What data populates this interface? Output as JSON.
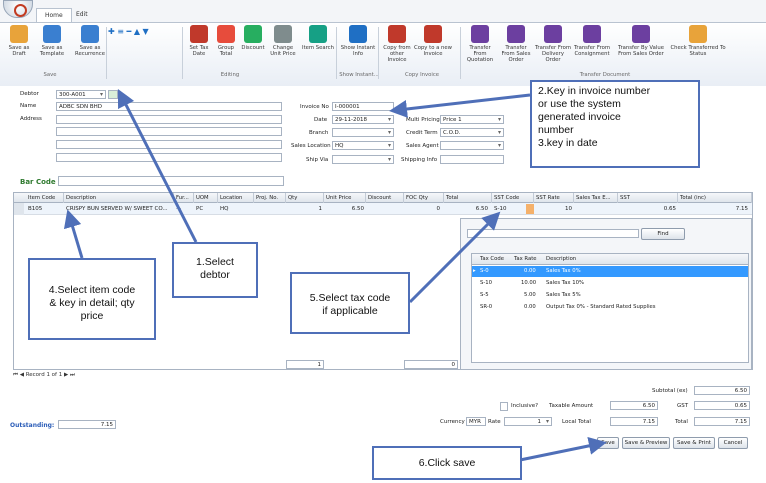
{
  "ribbon": {
    "tabs": [
      "Home",
      "Edit"
    ],
    "buttons": [
      {
        "label": "Save as Draft",
        "icon": "save-draft-icon",
        "color": "#e8a33a"
      },
      {
        "label": "Save as Template",
        "icon": "save-template-icon",
        "color": "#3a7fd0"
      },
      {
        "label": "Save as Recurrence",
        "icon": "save-recurrence-icon",
        "color": "#3a7fd0"
      },
      {
        "label": "Set Tax Date",
        "icon": "gst-icon",
        "color": "#c0392b"
      },
      {
        "label": "Group Total",
        "icon": "group-total-icon",
        "color": "#e74c3c"
      },
      {
        "label": "Discount",
        "icon": "discount-icon",
        "color": "#27ae60"
      },
      {
        "label": "Change Unit Price",
        "icon": "change-price-icon",
        "color": "#7f8c8d"
      },
      {
        "label": "Item Search",
        "icon": "item-search-icon",
        "color": "#16a085"
      },
      {
        "label": "Show Instant Info",
        "icon": "info-icon",
        "color": "#1f6fc4"
      },
      {
        "label": "Copy from other Invoice",
        "icon": "copy-invoice-icon",
        "color": "#c0392b"
      },
      {
        "label": "Copy to a new Invoice",
        "icon": "copy-new-invoice-icon",
        "color": "#c0392b"
      },
      {
        "label": "Transfer From Quotation",
        "icon": "transfer-quotation-icon",
        "color": "#6c3fa0"
      },
      {
        "label": "Transfer From Sales Order",
        "icon": "transfer-sales-order-icon",
        "color": "#6c3fa0"
      },
      {
        "label": "Transfer From Delivery Order",
        "icon": "transfer-delivery-icon",
        "color": "#6c3fa0"
      },
      {
        "label": "Transfer From Consignment",
        "icon": "transfer-consignment-icon",
        "color": "#6c3fa0"
      },
      {
        "label": "Transfer By Value From Sales Order",
        "icon": "transfer-by-value-icon",
        "color": "#6c3fa0"
      },
      {
        "label": "Check Transferred To Status",
        "icon": "check-status-icon",
        "color": "#e8a33a"
      }
    ],
    "groups": [
      "Save",
      "Editing",
      "Show Instant...",
      "Copy Invoice",
      "Transfer Document"
    ]
  },
  "header": {
    "debtor_label": "Debtor",
    "debtor_value": "300-A001",
    "name_label": "Name",
    "name_value": "ADBC SDN BHD",
    "address_label": "Address",
    "invoice_no_label": "Invoice No",
    "invoice_no_value": "I-000001",
    "date_label": "Date",
    "date_value": "29-11-2018",
    "branch_label": "Branch",
    "sales_location_label": "Sales Location",
    "sales_location_value": "HQ",
    "ship_via_label": "Ship Via",
    "multi_pricing_label": "Multi Pricing",
    "multi_pricing_value": "Price 1",
    "credit_term_label": "Credit Term",
    "credit_term_value": "C.O.D.",
    "sales_agent_label": "Sales Agent",
    "shipping_info_label": "Shipping Info",
    "barcode_label": "Bar Code"
  },
  "grid": {
    "columns": [
      "Item Code",
      "Description",
      "Fur...",
      "UOM",
      "Location",
      "Proj. No.",
      "Qty",
      "Unit Price",
      "Discount",
      "FOC Qty",
      "Total",
      "SST Code",
      "SST Rate",
      "Sales Tax E...",
      "SST",
      "Total (inc)"
    ],
    "row": {
      "item_code": "B105",
      "description": "CRISPY BUN SERVED W/ SWEET CO...",
      "furthers": "···",
      "uom": "PC",
      "location": "HQ",
      "qty": "1",
      "unit_price": "6.50",
      "foc_qty": "0",
      "total": "6.50",
      "sst_code": "S-10",
      "sst_rate": "10",
      "sst": "0.65",
      "total_inc": "7.15"
    },
    "footer_qty": "1",
    "footer_foc": "0"
  },
  "tax_popup": {
    "find_label": "Find",
    "columns": [
      "Tax Code",
      "Tax Rate",
      "Description"
    ],
    "rows": [
      {
        "code": "S-0",
        "rate": "0.00",
        "desc": "Sales Tax 0%"
      },
      {
        "code": "S-10",
        "rate": "10.00",
        "desc": "Sales Tax 10%"
      },
      {
        "code": "S-5",
        "rate": "5.00",
        "desc": "Sales Tax 5%"
      },
      {
        "code": "SR-0",
        "rate": "0.00",
        "desc": "Output Tax 0% - Standard Rated Supplies"
      }
    ]
  },
  "navigator": {
    "record_text": "Record 1 of 1"
  },
  "totals": {
    "subtotal_label": "Subtotal (ex)",
    "subtotal_value": "6.50",
    "inclusive_label": "Inclusive?",
    "taxable_label": "Taxable Amount",
    "taxable_value": "6.50",
    "gst_label": "GST",
    "gst_value": "0.65",
    "currency_label": "Currency",
    "currency_value": "MYR",
    "rate_label": "Rate",
    "rate_value": "1",
    "local_total_label": "Local Total",
    "local_total_value": "7.15",
    "total_label": "Total",
    "total_value": "7.15"
  },
  "outstanding": {
    "label": "Outstanding:",
    "value": "7.15"
  },
  "actions": {
    "save": "Save",
    "save_preview": "Save & Preview",
    "save_print": "Save & Print",
    "cancel": "Cancel"
  },
  "callouts": {
    "invoice": [
      "2.Key in invoice number",
      "or use the system",
      "generated invoice",
      "number",
      "3.key in date"
    ],
    "item": [
      "4.Select item code",
      "& key in detail; qty",
      "price"
    ],
    "debtor": [
      "1.Select",
      "debtor"
    ],
    "tax": [
      "5.Select tax code",
      "if applicable"
    ],
    "save": "6.Click save"
  },
  "accent_color": "#4f6fb8"
}
